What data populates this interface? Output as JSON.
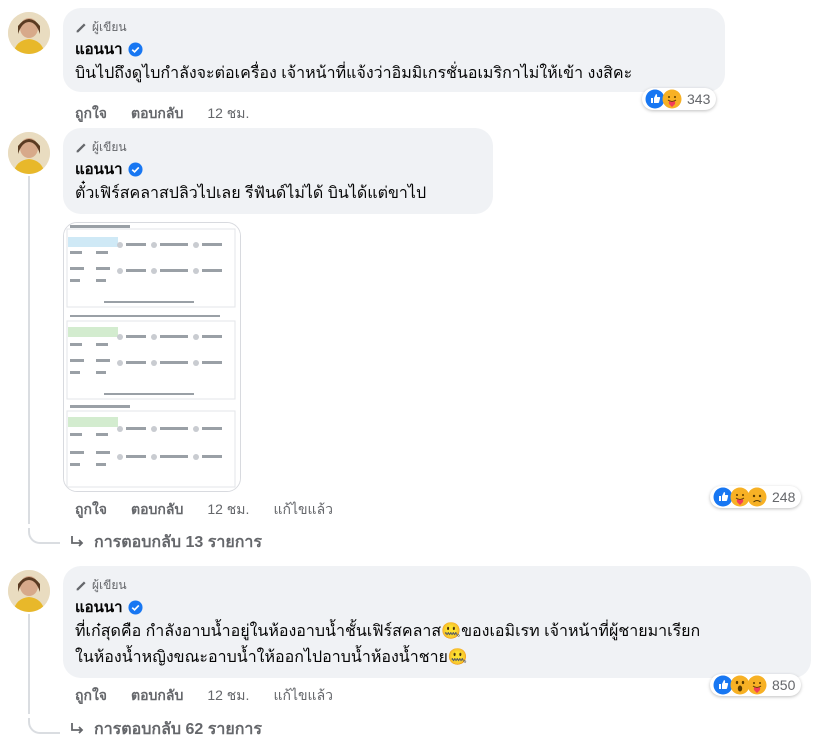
{
  "comments": [
    {
      "author_tag": "ผู้เขียน",
      "name": "แอนนา",
      "lines": [
        "บินไปถึงดูไบกำลังจะต่อเครื่อง เจ้าหน้าที่แจ้งว่าอิมมิเกรชั่นอเมริกาไม่ให้เข้า งงสิคะ"
      ],
      "actions": {
        "like": "ถูกใจ",
        "reply": "ตอบกลับ",
        "time": "12 ชม."
      },
      "reactions": {
        "count": "343",
        "icons": [
          "like-icon",
          "care-icon"
        ]
      }
    },
    {
      "author_tag": "ผู้เขียน",
      "name": "แอนนา",
      "lines": [
        "ตั๋วเฟิร์สคลาสปลิวไปเลย รีฟันด์ไม่ได้ บินได้แต่ขาไป"
      ],
      "actions": {
        "like": "ถูกใจ",
        "reply": "ตอบกลับ",
        "time": "12 ชม.",
        "edited": "แก้ไขแล้ว"
      },
      "reactions": {
        "count": "248",
        "icons": [
          "like-icon",
          "care-icon",
          "sad-icon"
        ]
      },
      "replies_label": "การตอบกลับ 13 รายการ"
    },
    {
      "author_tag": "ผู้เขียน",
      "name": "แอนนา",
      "lines": [
        "ที่เก๋สุดคือ กำลังอาบน้ำอยู่ในห้องอาบน้ำชั้นเฟิร์สคลาส🤐ของเอมิเรท เจ้าหน้าที่ผู้ชายมาเรียก",
        "ในห้องน้ำหญิงขณะอาบน้ำให้ออกไปอาบน้ำห้องน้ำชาย🤐"
      ],
      "actions": {
        "like": "ถูกใจ",
        "reply": "ตอบกลับ",
        "time": "12 ชม.",
        "edited": "แก้ไขแล้ว"
      },
      "reactions": {
        "count": "850",
        "icons": [
          "like-icon",
          "wow-icon",
          "care-icon"
        ]
      },
      "replies_label": "การตอบกลับ 62 รายการ"
    }
  ],
  "colors": {
    "bubble": "#f0f2f5",
    "like_blue": "#1877f2",
    "secondary_text": "#65676b"
  }
}
